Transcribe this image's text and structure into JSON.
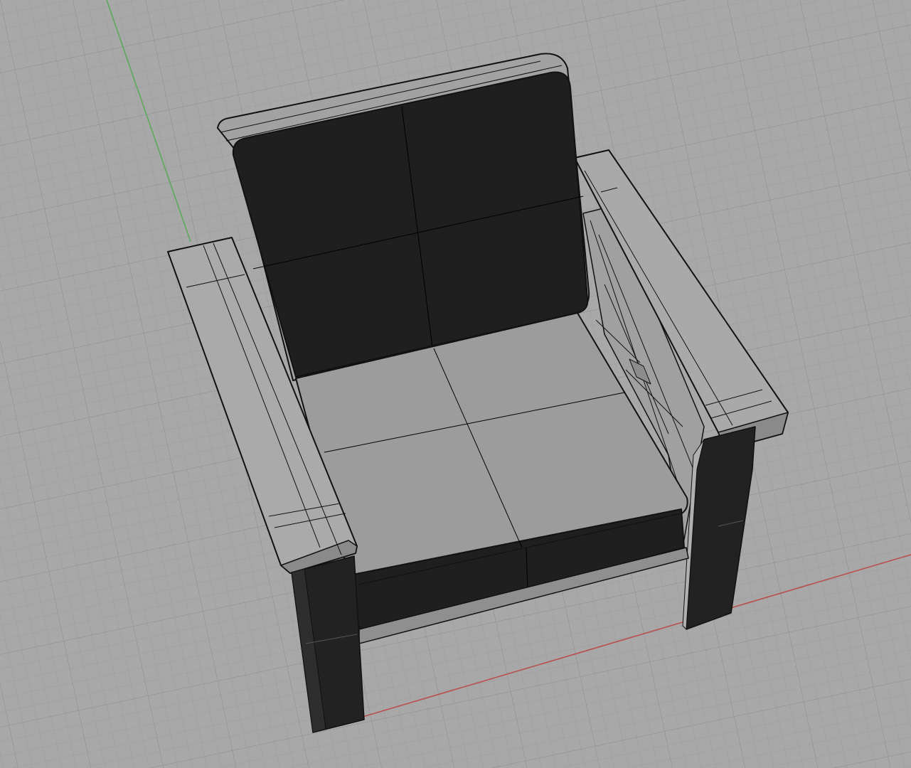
{
  "viewport": {
    "view_mode": "perspective",
    "display_mode": "shaded",
    "background_color": "#a8a8a8",
    "grid": true,
    "grid_color": "#989898",
    "x_axis_color": "#b85050",
    "y_axis_color": "#5ca85c"
  },
  "model": {
    "object": "armchair",
    "components": [
      "back-cushion",
      "seat-cushion",
      "left-armrest",
      "right-armrest",
      "legs",
      "side-lattice"
    ],
    "cushion_color": "#1f1f1f",
    "seat_color": "#9a9a9a",
    "frame_color": "#a6a6a6",
    "edge_color": "#111111"
  }
}
